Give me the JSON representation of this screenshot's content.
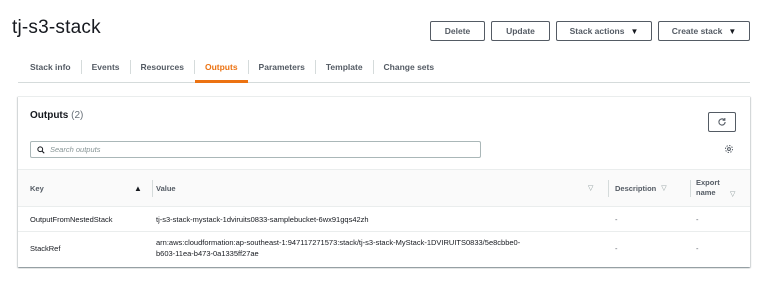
{
  "header": {
    "title": "tj-s3-stack",
    "buttons": {
      "delete": "Delete",
      "update": "Update",
      "stack_actions": "Stack actions",
      "create_stack": "Create stack"
    }
  },
  "tabs": [
    {
      "label": "Stack info",
      "active": false
    },
    {
      "label": "Events",
      "active": false
    },
    {
      "label": "Resources",
      "active": false
    },
    {
      "label": "Outputs",
      "active": true
    },
    {
      "label": "Parameters",
      "active": false
    },
    {
      "label": "Template",
      "active": false
    },
    {
      "label": "Change sets",
      "active": false
    }
  ],
  "outputs": {
    "title": "Outputs",
    "count": "(2)",
    "search_placeholder": "Search outputs",
    "columns": {
      "key": "Key",
      "value": "Value",
      "description": "Description",
      "export_name_line1": "Export",
      "export_name_line2": "name"
    },
    "rows": [
      {
        "key": "OutputFromNestedStack",
        "value": "tj-s3-stack-mystack-1dviruits0833-samplebucket-6wx91gqs42zh",
        "description": "-",
        "export_name": "-"
      },
      {
        "key": "StackRef",
        "value_line1": "arn:aws:cloudformation:ap-southeast-1:947117271573:stack/tj-s3-stack-MyStack-1DVIRUITS0833/5e8cbbe0-",
        "value_line2": "b603-11ea-b473-0a1335ff27ae",
        "description": "-",
        "export_name": "-"
      }
    ]
  },
  "colors": {
    "accent": "#ec7211",
    "text": "#16191f",
    "muted": "#545b64",
    "border": "#eaeded"
  }
}
